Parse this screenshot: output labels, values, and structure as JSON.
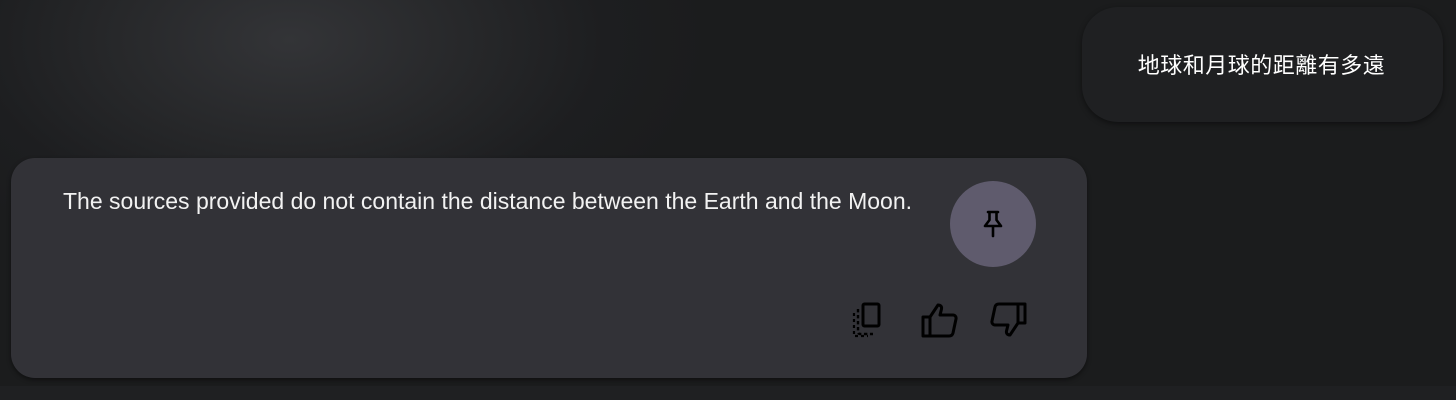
{
  "user_message": {
    "text": "地球和月球的距離有多遠"
  },
  "response": {
    "text": "The sources provided do not contain the distance between the Earth and the Moon.",
    "actions": {
      "pin_icon": "pin-icon",
      "copy_icon": "copy-icon",
      "thumbs_up_icon": "thumbs-up-icon",
      "thumbs_down_icon": "thumbs-down-icon"
    }
  },
  "colors": {
    "background": "#1d1e20",
    "user_bubble": "#1f2022",
    "response_card": "#323237",
    "pin_button": "#5f5b6d",
    "text": "#ffffff",
    "icon": "#000000"
  }
}
